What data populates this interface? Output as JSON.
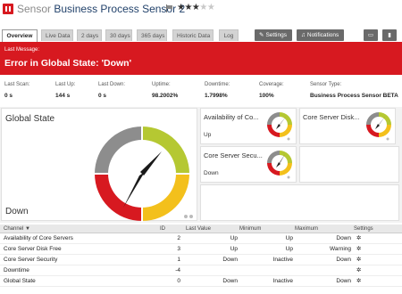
{
  "header": {
    "prefix": "Sensor",
    "name": "Business Process Sensor 2",
    "stars_on": "★★★",
    "stars_off": "★★"
  },
  "tabs": [
    {
      "label": "Overview",
      "active": true
    },
    {
      "label": "Live Data"
    },
    {
      "label": "2 days"
    },
    {
      "label": "30 days"
    },
    {
      "label": "365 days"
    },
    {
      "label": "Historic Data"
    },
    {
      "label": "Log"
    }
  ],
  "toolbar": {
    "settings_label": "Settings",
    "notifications_label": "Notifications"
  },
  "error": {
    "label": "Last Message:",
    "message": "Error in Global State: 'Down'"
  },
  "stats": [
    {
      "key": "Last Scan:",
      "value": "0 s"
    },
    {
      "key": "Last Up:",
      "value": "144 s"
    },
    {
      "key": "Last Down:",
      "value": "0 s"
    },
    {
      "key": "Uptime:",
      "value": "98.2002%"
    },
    {
      "key": "Downtime:",
      "value": "1.7998%"
    },
    {
      "key": "Coverage:",
      "value": "100%"
    },
    {
      "key": "Sensor Type:",
      "value": "Business Process Sensor BETA"
    }
  ],
  "gauges": {
    "main": {
      "title": "Global State",
      "status": "Down"
    },
    "small": [
      {
        "title": "Availability of Co...",
        "status": "Up"
      },
      {
        "title": "Core Server Disk...",
        "status": ""
      },
      {
        "title": "Core Server Secu...",
        "status": "Down"
      }
    ]
  },
  "table": {
    "headers": {
      "channel": "Channel ▼",
      "id": "ID",
      "last_value": "Last Value",
      "minimum": "Minimum",
      "maximum": "Maximum",
      "settings": "Settings"
    },
    "rows": [
      {
        "channel": "Availability of Core Servers",
        "id": "2",
        "last": "Up",
        "min": "Up",
        "max": "Down"
      },
      {
        "channel": "Core Server Disk Free",
        "id": "3",
        "last": "Up",
        "min": "Up",
        "max": "Warning"
      },
      {
        "channel": "Core Server Security",
        "id": "1",
        "last": "Down",
        "min": "Inactive",
        "max": "Down"
      },
      {
        "channel": "Downtime",
        "id": "-4",
        "last": "",
        "min": "",
        "max": ""
      },
      {
        "channel": "Global State",
        "id": "0",
        "last": "Down",
        "min": "Inactive",
        "max": "Down"
      }
    ]
  },
  "colors": {
    "error_red": "#d71920",
    "gauge_green": "#b5c832",
    "gauge_yellow": "#f3c01c",
    "gauge_red": "#d71920",
    "gauge_gray": "#8d8d8d"
  }
}
